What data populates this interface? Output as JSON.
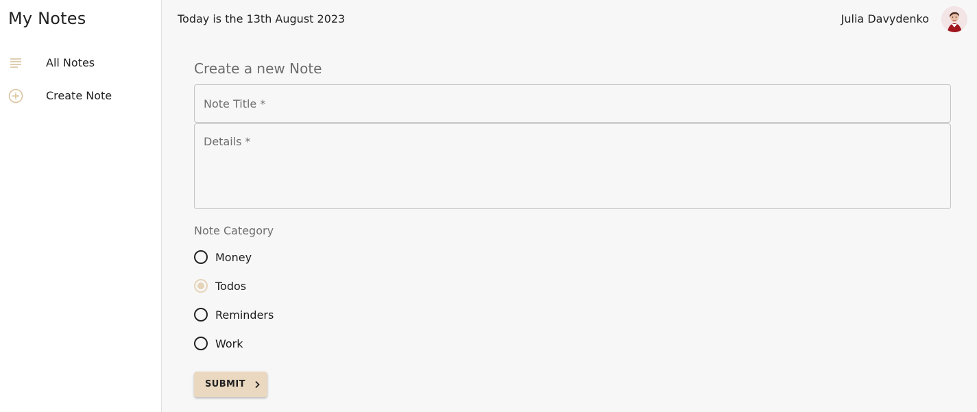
{
  "sidebar": {
    "title": "My Notes",
    "items": [
      {
        "label": "All Notes",
        "icon": "notes-list-icon"
      },
      {
        "label": "Create Note",
        "icon": "add-circle-icon"
      }
    ]
  },
  "header": {
    "date_text": "Today is the 13th August 2023",
    "user_name": "Julia Davydenko"
  },
  "form": {
    "heading": "Create a new Note",
    "title_placeholder": "Note Title *",
    "details_placeholder": "Details *",
    "category_label": "Note Category",
    "categories": [
      {
        "label": "Money",
        "selected": false
      },
      {
        "label": "Todos",
        "selected": true
      },
      {
        "label": "Reminders",
        "selected": false
      },
      {
        "label": "Work",
        "selected": false
      }
    ],
    "submit_label": "SUBMIT"
  },
  "colors": {
    "accent": "#e6d4b8",
    "button": "#ead8c0",
    "sidebar_bg": "#ffffff",
    "page_bg": "#f7f7f7"
  }
}
